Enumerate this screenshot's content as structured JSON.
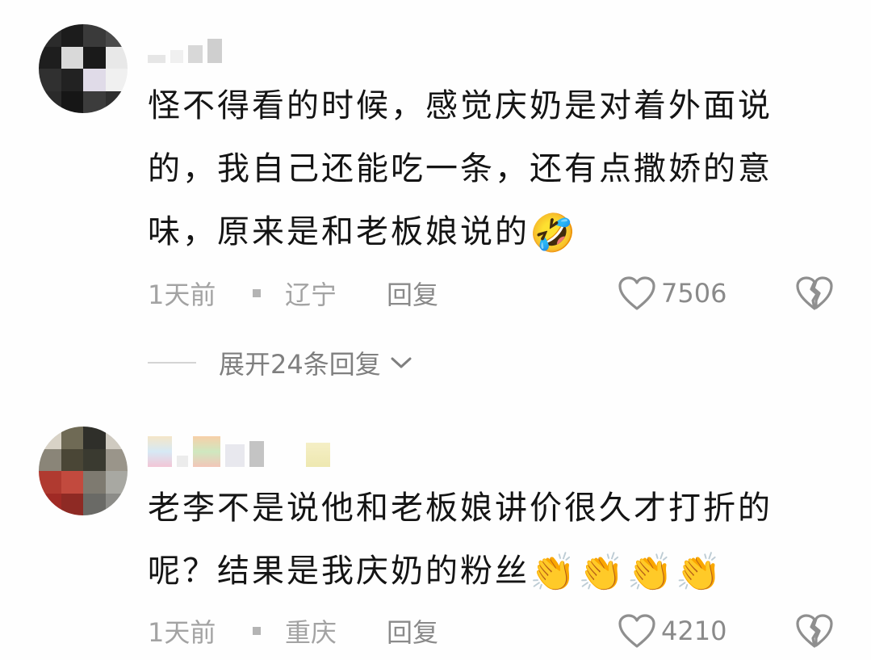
{
  "colors": {
    "background": "#fefefe",
    "text": "#141414",
    "meta": "#a3a3a3",
    "icon": "#8f8f8f"
  },
  "comments": [
    {
      "avatar": "blurred-avatar",
      "text": "怪不得看的时候，感觉庆奶是对着外面说的，我自己还能吃一条，还有点撒娇的意味，原来是和老板娘说的",
      "emoji": "🤣",
      "time": "1天前",
      "location": "辽宁",
      "reply": "回复",
      "likes": "7506",
      "like_icon": "heart-outline-icon",
      "dislike_icon": "broken-heart-icon",
      "expand_replies": "展开24条回复"
    },
    {
      "avatar": "blurred-avatar",
      "text": "老李不是说他和老板娘讲价很久才打折的呢？结果是我庆奶的粉丝",
      "emoji": "👏👏👏👏",
      "time": "1天前",
      "location": "重庆",
      "reply": "回复",
      "likes": "4210",
      "like_icon": "heart-outline-icon",
      "dislike_icon": "broken-heart-icon"
    }
  ]
}
